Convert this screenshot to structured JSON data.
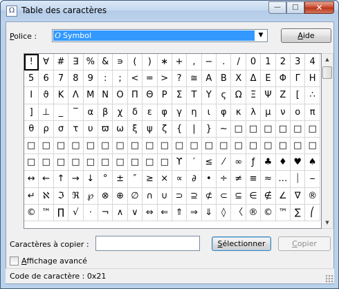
{
  "window": {
    "title": "Table des caractères"
  },
  "caption": {
    "minimize": "—",
    "maximize": "□",
    "close": "✕"
  },
  "font": {
    "label_pre": "",
    "label_u": "P",
    "label_post": "olice :",
    "value": "Symbol",
    "font_glyph": "O"
  },
  "help_button": {
    "u": "A",
    "rest": "ide"
  },
  "characters": [
    "!",
    "∀",
    "#",
    "∃",
    "%",
    "&",
    "∍",
    "(",
    ")",
    "∗",
    "+",
    ",",
    "−",
    ".",
    "/",
    "0",
    "1",
    "2",
    "3",
    "4",
    "5",
    "6",
    "7",
    "8",
    "9",
    ":",
    ";",
    "<",
    "=",
    ">",
    "?",
    "≅",
    "Α",
    "Β",
    "Χ",
    "Δ",
    "Ε",
    "Φ",
    "Γ",
    "Η",
    "Ι",
    "ϑ",
    "Κ",
    "Λ",
    "Μ",
    "Ν",
    "Ο",
    "Π",
    "Θ",
    "Ρ",
    "Σ",
    "Τ",
    "Υ",
    "ς",
    "Ω",
    "Ξ",
    "Ψ",
    "Ζ",
    "[",
    "∴",
    "]",
    "⊥",
    "_",
    "‾",
    "α",
    "β",
    "χ",
    "δ",
    "ε",
    "φ",
    "γ",
    "η",
    "ι",
    "φ",
    "κ",
    "λ",
    "μ",
    "ν",
    "ο",
    "π",
    "θ",
    "ρ",
    "σ",
    "τ",
    "υ",
    "ϖ",
    "ω",
    "ξ",
    "ψ",
    "ζ",
    "{",
    "|",
    "}",
    "~",
    "□",
    "□",
    "□",
    "□",
    "□",
    "□",
    "□",
    "□",
    "□",
    "□",
    "□",
    "□",
    "□",
    "□",
    "□",
    "□",
    "□",
    "□",
    "□",
    "□",
    "□",
    "□",
    "□",
    "□",
    "□",
    "□",
    "□",
    "□",
    "□",
    "□",
    "□",
    "□",
    "□",
    "□",
    "□",
    "□",
    "ϒ",
    "′",
    "≤",
    "⁄",
    "∞",
    "ƒ",
    "♣",
    "♦",
    "♥",
    "♠",
    "↔",
    "←",
    "↑",
    "→",
    "↓",
    "°",
    "±",
    "″",
    "≥",
    "×",
    "∝",
    "∂",
    "•",
    "÷",
    "≠",
    "≡",
    "≈",
    "…",
    "⏐",
    "⎯",
    "↵",
    "ℵ",
    "ℑ",
    "ℜ",
    "℘",
    "⊗",
    "⊕",
    "∅",
    "∩",
    "∪",
    "⊃",
    "⊇",
    "⊄",
    "⊂",
    "⊆",
    "∈",
    "∉",
    "∠",
    "∇",
    "®",
    "©",
    "™",
    "∏",
    "√",
    "⋅",
    "¬",
    "∧",
    "∨",
    "⇔",
    "⇐",
    "⇑",
    "⇒",
    "⇓",
    "◊",
    "〈",
    "®",
    "©",
    "™",
    "∑",
    "⎛",
    "⎜",
    "⎝"
  ],
  "grid": {
    "selected_index": 0,
    "visible_count": 200
  },
  "copy": {
    "label": "Caractères à copier :",
    "value": ""
  },
  "select_button": {
    "u": "S",
    "rest": "électionner"
  },
  "copy_button": {
    "u": "C",
    "rest": "opier"
  },
  "advanced": {
    "u": "A",
    "rest": "ffichage avancé",
    "checked": false
  },
  "status": {
    "text": "Code de caractère : 0x21"
  }
}
